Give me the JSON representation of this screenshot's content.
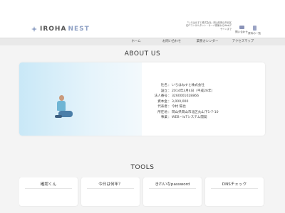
{
  "header": {
    "logo_part1": "IROHA",
    "logo_part2": "NEST",
    "tagline": "「いろはねすと株式会社」岡山県岡山市北区在ITコンサルタント・サーバ構築からWebデザインまで",
    "buttons": [
      {
        "label": "問い合わせ",
        "icon": "mail-icon"
      },
      {
        "label": "資料の一覧",
        "icon": "document-icon"
      }
    ]
  },
  "nav": {
    "items": [
      "ホーム",
      "お問い合わせ",
      "業務カレンダー",
      "アクセスマップ"
    ]
  },
  "about": {
    "title": "ABOUT US",
    "rows": [
      {
        "k": "社名",
        "v": "いろはねすと株式会社"
      },
      {
        "k": "設立",
        "v": "2014年3月4日（平成26年）"
      },
      {
        "k": "法人番号",
        "v": "3260001028866"
      },
      {
        "k": "資本金",
        "v": "3,000,000"
      },
      {
        "k": "代表者",
        "v": "今村 陽也"
      },
      {
        "k": "所在地",
        "v": "岡山県岡山市北区丸山下1-7-10"
      },
      {
        "k": "事業",
        "v": "WEB・IoTシステム開発"
      }
    ]
  },
  "tools": {
    "title": "TOOLS",
    "items": [
      "確認くん",
      "今日は何年？",
      "きれいなpassword",
      "DNSチェック"
    ]
  }
}
